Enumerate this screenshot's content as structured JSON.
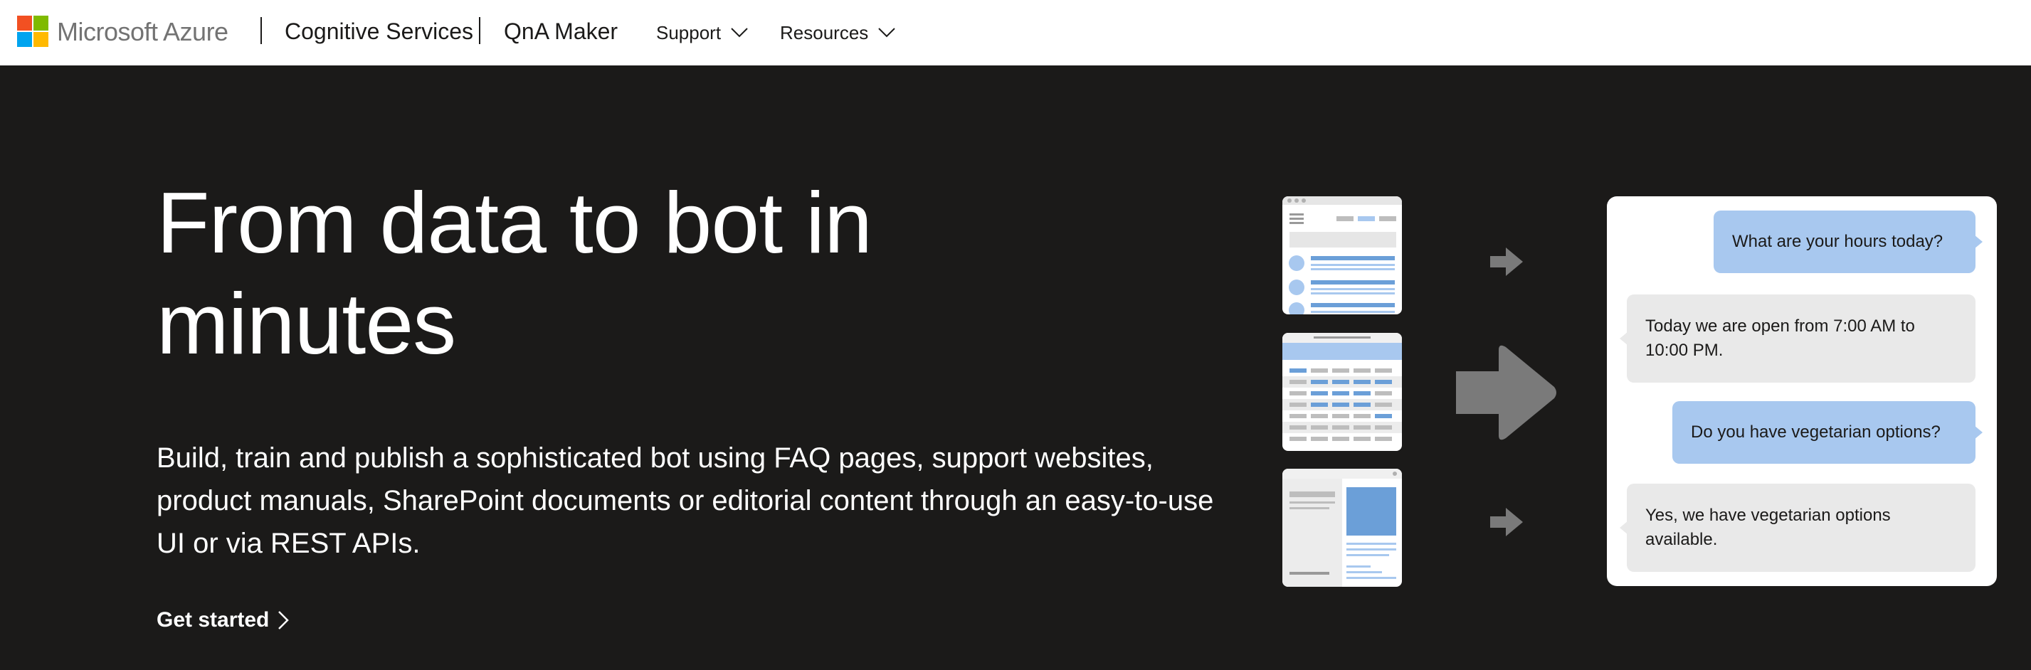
{
  "header": {
    "brand": "Microsoft Azure",
    "service": "Cognitive Services",
    "product": "QnA Maker",
    "nav": [
      {
        "label": "Support"
      },
      {
        "label": "Resources"
      }
    ],
    "logo_colors": [
      "#f25022",
      "#7fba00",
      "#00a4ef",
      "#ffb900"
    ]
  },
  "hero": {
    "title": "From data to bot in minutes",
    "description": "Build, train and publish a sophisticated bot using FAQ pages, support websites, product manuals, SharePoint documents or editorial content through an easy-to-use UI or via REST APIs.",
    "cta": "Get started",
    "background": "#1b1a19"
  },
  "chat": {
    "messages": [
      {
        "role": "user",
        "text": "What are your hours today?"
      },
      {
        "role": "bot",
        "text": "Today we are open from 7:00 AM to 10:00 PM."
      },
      {
        "role": "user",
        "text": "Do you have vegetarian options?"
      },
      {
        "role": "bot",
        "text": "Yes, we have vegetarian options available."
      }
    ],
    "user_color": "#a8c8ef",
    "bot_color": "#e9e9e9"
  }
}
